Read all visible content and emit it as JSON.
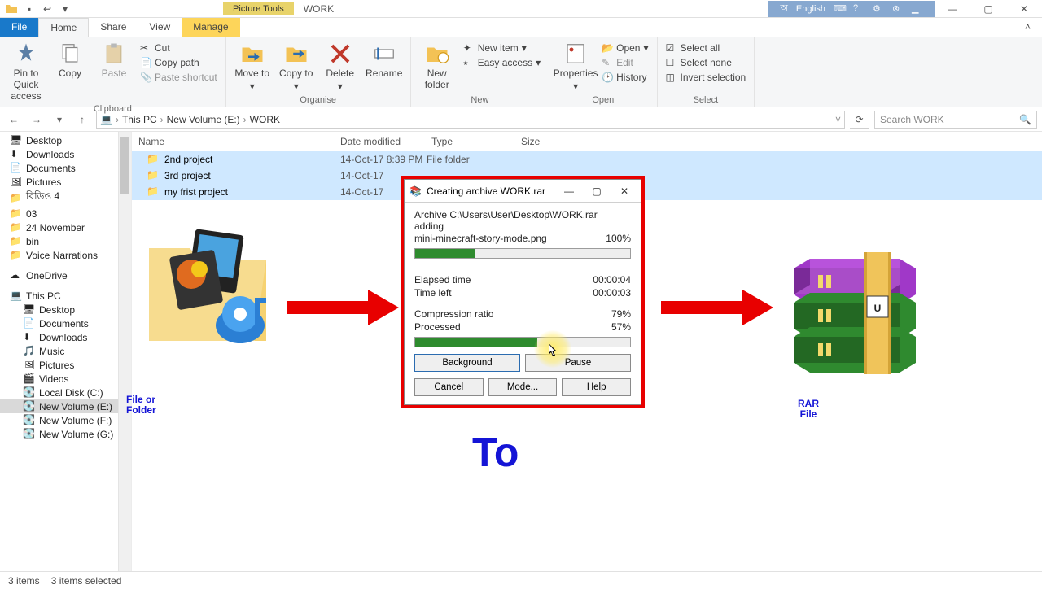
{
  "titlebar": {
    "context_tab": "Picture Tools",
    "title": "WORK",
    "lang": "English"
  },
  "tabs": {
    "file": "File",
    "home": "Home",
    "share": "Share",
    "view": "View",
    "manage": "Manage"
  },
  "ribbon": {
    "clipboard": {
      "label": "Clipboard",
      "pin": "Pin to Quick access",
      "copy": "Copy",
      "paste": "Paste",
      "cut": "Cut",
      "copypath": "Copy path",
      "pasteshortcut": "Paste shortcut"
    },
    "organise": {
      "label": "Organise",
      "moveto": "Move to",
      "copyto": "Copy to",
      "delete": "Delete",
      "rename": "Rename"
    },
    "new": {
      "label": "New",
      "newfolder": "New folder",
      "newitem": "New item",
      "easyaccess": "Easy access"
    },
    "open": {
      "label": "Open",
      "properties": "Properties",
      "open": "Open",
      "edit": "Edit",
      "history": "History"
    },
    "select": {
      "label": "Select",
      "selectall": "Select all",
      "selectnone": "Select none",
      "invert": "Invert selection"
    }
  },
  "breadcrumbs": {
    "root": "This PC",
    "vol": "New Volume (E:)",
    "folder": "WORK"
  },
  "search": {
    "placeholder": "Search WORK"
  },
  "columns": {
    "name": "Name",
    "date": "Date modified",
    "type": "Type",
    "size": "Size"
  },
  "rows": [
    {
      "name": "2nd project",
      "date": "14-Oct-17 8:39 PM",
      "type": "File folder"
    },
    {
      "name": "3rd project",
      "date": "14-Oct-17",
      "type": ""
    },
    {
      "name": "my frist project",
      "date": "14-Oct-17",
      "type": ""
    }
  ],
  "tree": {
    "quick": [
      "Desktop",
      "Downloads",
      "Documents",
      "Pictures",
      "বিডিও 4",
      "03",
      "24 November",
      "bin",
      "Voice Narrations"
    ],
    "onedrive": "OneDrive",
    "thispc": "This PC",
    "pc": [
      "Desktop",
      "Documents",
      "Downloads",
      "Music",
      "Pictures",
      "Videos",
      "Local Disk (C:)",
      "New Volume (E:)",
      "New Volume (F:)",
      "New Volume (G:)"
    ]
  },
  "status": {
    "items": "3 items",
    "selected": "3 items selected"
  },
  "dialog": {
    "title": "Creating archive WORK.rar",
    "archive_label": "Archive C:\\Users\\User\\Desktop\\WORK.rar",
    "adding": "adding",
    "file": "mini-minecraft-story-mode.png",
    "file_pct": "100%",
    "elapsed_l": "Elapsed time",
    "elapsed_v": "00:00:04",
    "left_l": "Time left",
    "left_v": "00:00:03",
    "ratio_l": "Compression ratio",
    "ratio_v": "79%",
    "proc_l": "Processed",
    "proc_v": "57%",
    "btn_bg": "Background",
    "btn_pause": "Pause",
    "btn_cancel": "Cancel",
    "btn_mode": "Mode...",
    "btn_help": "Help"
  },
  "labels": {
    "left1": "File or",
    "left2": "Folder",
    "mid": "To",
    "right1": "RAR",
    "right2": "File"
  }
}
